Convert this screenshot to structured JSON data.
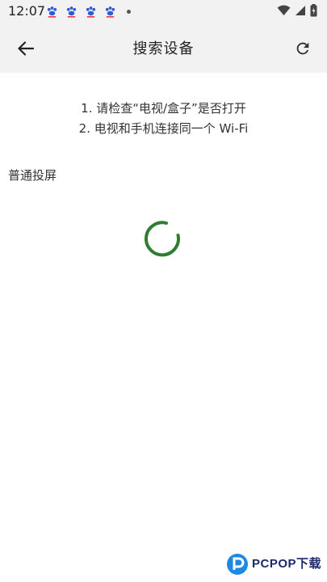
{
  "status_bar": {
    "time": "12:07",
    "notification_icons": [
      "baidu-paw-icon",
      "baidu-paw-icon",
      "baidu-paw-icon",
      "baidu-paw-icon",
      "more-dot-icon"
    ],
    "system_icons": [
      "wifi-icon",
      "cellular-signal-icon",
      "battery-charging-icon"
    ]
  },
  "app_bar": {
    "title": "搜索设备",
    "back_icon": "arrow-left-icon",
    "refresh_icon": "refresh-icon"
  },
  "instructions": {
    "line1": "1. 请检查“电视/盒子”是否打开",
    "line2": "2. 电视和手机连接同一个 Wi-Fi"
  },
  "section": {
    "label": "普通投屏"
  },
  "loading": {
    "icon": "loading-spinner-icon",
    "color": "#2e7d32"
  },
  "watermark": {
    "brand": "PCPOP下载"
  },
  "colors": {
    "bar_background": "#f2f2f2",
    "spinner_green": "#2e7d32",
    "paw_blue": "#2f5bd3"
  }
}
